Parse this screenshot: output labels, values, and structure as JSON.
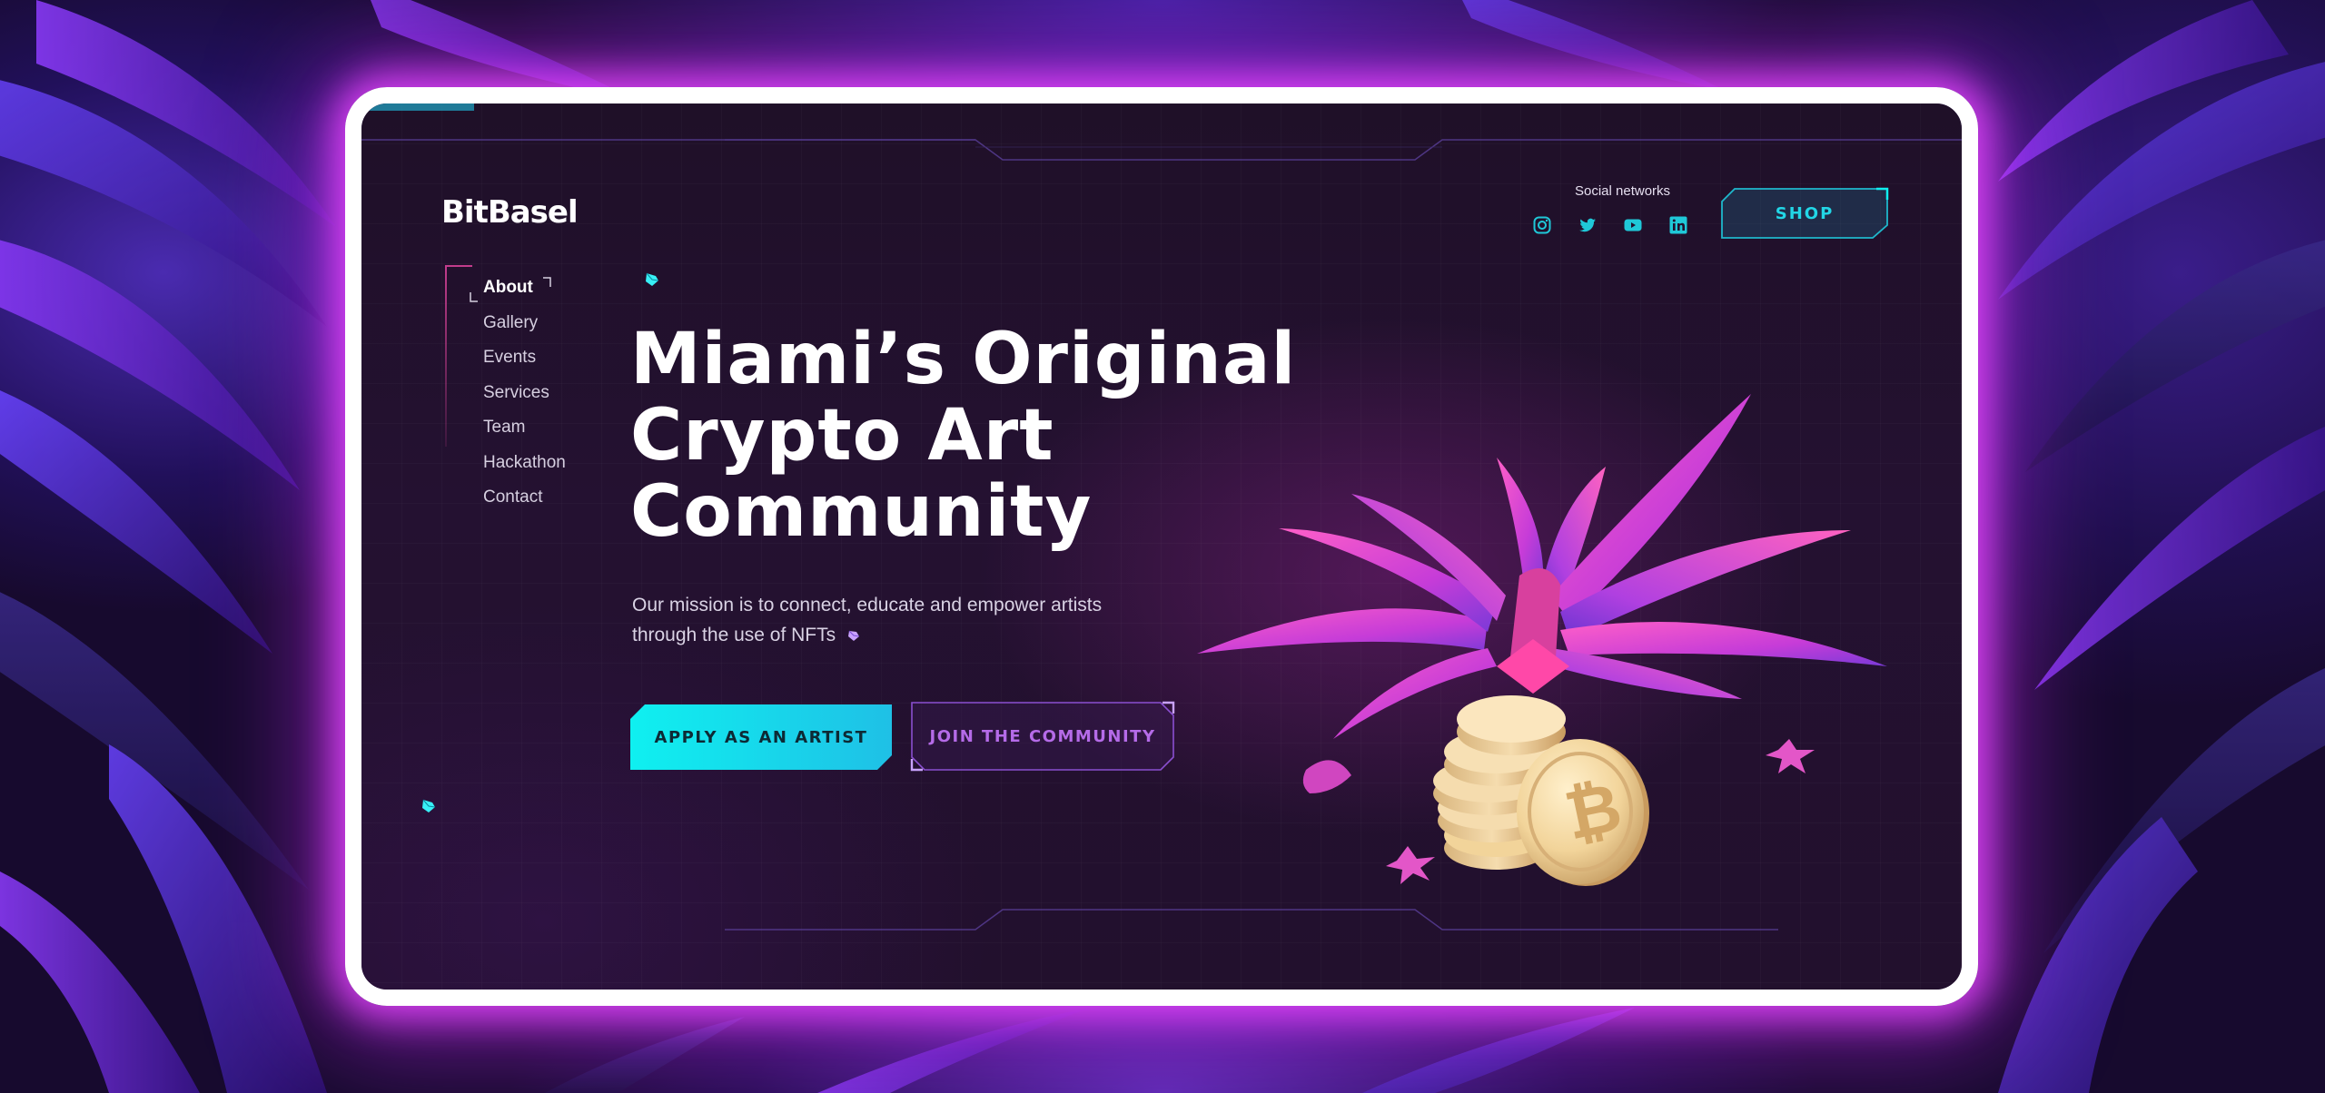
{
  "brand": {
    "logo_text": "BitBasel"
  },
  "header": {
    "social_label": "Social networks",
    "social_icons": [
      "instagram-icon",
      "twitter-icon",
      "youtube-icon",
      "linkedin-icon"
    ],
    "shop_label": "SHOP"
  },
  "nav": {
    "items": [
      {
        "label": "About",
        "active": true
      },
      {
        "label": "Gallery",
        "active": false
      },
      {
        "label": "Events",
        "active": false
      },
      {
        "label": "Services",
        "active": false
      },
      {
        "label": "Team",
        "active": false
      },
      {
        "label": "Hackathon",
        "active": false
      },
      {
        "label": "Contact",
        "active": false
      }
    ]
  },
  "hero": {
    "headline_lines": [
      "Miami’s Original",
      "Crypto Art",
      "Community"
    ],
    "mission": "Our mission is to connect, educate and empower artists through the use of NFTs",
    "apply_label": "APPLY AS AN ARTIST",
    "join_label": "JOIN THE COMMUNITY"
  },
  "colors": {
    "accent_cyan": "#0ff0f0",
    "accent_purple": "#b56be8",
    "frame_glow": "#e846ff",
    "screen_bg": "#22102d"
  }
}
